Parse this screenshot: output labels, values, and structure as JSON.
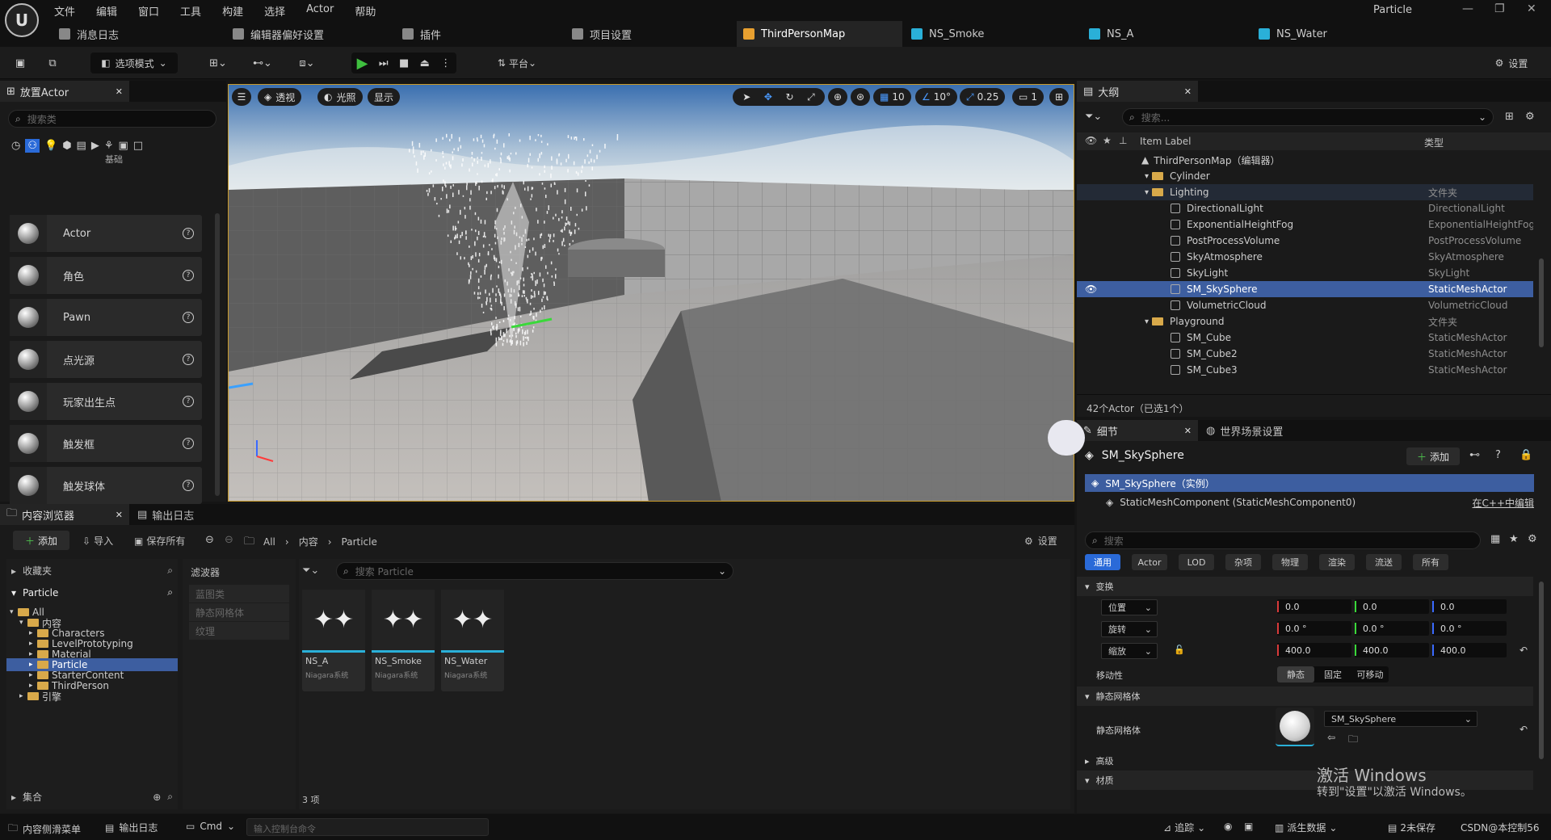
{
  "menus": [
    "文件",
    "编辑",
    "窗口",
    "工具",
    "构建",
    "选择",
    "Actor",
    "帮助"
  ],
  "project_name": "Particle",
  "tabs": [
    {
      "label": "消息日志",
      "icon": "message-log-icon"
    },
    {
      "label": "编辑器偏好设置",
      "icon": "sliders-icon"
    },
    {
      "label": "插件",
      "icon": "plugin-icon"
    },
    {
      "label": "项目设置",
      "icon": "gear-icon"
    },
    {
      "label": "ThirdPersonMap",
      "icon": "level-icon"
    },
    {
      "label": "NS_Smoke",
      "icon": "niagara-icon"
    },
    {
      "label": "NS_A",
      "icon": "niagara-icon"
    },
    {
      "label": "NS_Water",
      "icon": "niagara-icon"
    }
  ],
  "toolbar": {
    "mode": "选项模式",
    "platform": "平台",
    "settings": "设置"
  },
  "place_actor": {
    "title": "放置Actor",
    "search_placeholder": "搜索类",
    "category": "基础",
    "items": [
      "Actor",
      "角色",
      "Pawn",
      "点光源",
      "玩家出生点",
      "触发框",
      "触发球体"
    ]
  },
  "viewport": {
    "perspective": "透视",
    "lit": "光照",
    "show": "显示",
    "grid": "10",
    "angle": "10°",
    "scale": "0.25",
    "camera": "1"
  },
  "outliner": {
    "title": "大纲",
    "search_placeholder": "搜索...",
    "col_label": "Item Label",
    "col_type": "类型",
    "rows": [
      {
        "label": "ThirdPersonMap（编辑器）",
        "type": "",
        "indent": 0,
        "kind": "level"
      },
      {
        "label": "Cylinder",
        "type": "",
        "indent": 1,
        "kind": "folder"
      },
      {
        "label": "Lighting",
        "type": "文件夹",
        "indent": 1,
        "kind": "folder"
      },
      {
        "label": "DirectionalLight",
        "type": "DirectionalLight",
        "indent": 2,
        "kind": "actor"
      },
      {
        "label": "ExponentialHeightFog",
        "type": "ExponentialHeightFog",
        "indent": 2,
        "kind": "actor"
      },
      {
        "label": "PostProcessVolume",
        "type": "PostProcessVolume",
        "indent": 2,
        "kind": "actor"
      },
      {
        "label": "SkyAtmosphere",
        "type": "SkyAtmosphere",
        "indent": 2,
        "kind": "actor"
      },
      {
        "label": "SkyLight",
        "type": "SkyLight",
        "indent": 2,
        "kind": "actor"
      },
      {
        "label": "SM_SkySphere",
        "type": "StaticMeshActor",
        "indent": 2,
        "kind": "actor",
        "selected": true
      },
      {
        "label": "VolumetricCloud",
        "type": "VolumetricCloud",
        "indent": 2,
        "kind": "actor"
      },
      {
        "label": "Playground",
        "type": "文件夹",
        "indent": 1,
        "kind": "folder"
      },
      {
        "label": "SM_Cube",
        "type": "StaticMeshActor",
        "indent": 2,
        "kind": "actor"
      },
      {
        "label": "SM_Cube2",
        "type": "StaticMeshActor",
        "indent": 2,
        "kind": "actor"
      },
      {
        "label": "SM_Cube3",
        "type": "StaticMeshActor",
        "indent": 2,
        "kind": "actor"
      }
    ],
    "count": "42个Actor（已选1个）"
  },
  "details": {
    "tab": "细节",
    "tab2": "世界场景设置",
    "actor_name": "SM_SkySphere",
    "add": "添加",
    "instance": "SM_SkySphere（实例）",
    "component": "StaticMeshComponent (StaticMeshComponent0)",
    "edit_cpp": "在C++中编辑",
    "search_placeholder": "搜索",
    "categories": [
      "通用",
      "Actor",
      "LOD",
      "杂项",
      "物理",
      "渲染",
      "流送",
      "所有"
    ],
    "transform_section": "变换",
    "location_label": "位置",
    "rotation_label": "旋转",
    "scale_label": "缩放",
    "location": [
      "0.0",
      "0.0",
      "0.0"
    ],
    "rotation": [
      "0.0 °",
      "0.0 °",
      "0.0 °"
    ],
    "scale": [
      "400.0",
      "400.0",
      "400.0"
    ],
    "mobility_label": "移动性",
    "mobility": [
      "静态",
      "固定",
      "可移动"
    ],
    "mesh_section": "静态网格体",
    "mesh_label": "静态网格体",
    "mesh_value": "SM_SkySphere",
    "advanced": "高级",
    "materials": "材质"
  },
  "content_browser": {
    "tab": "内容浏览器",
    "tab2": "输出日志",
    "add": "添加",
    "import": "导入",
    "save_all": "保存所有",
    "path": [
      "All",
      "内容",
      "Particle"
    ],
    "settings": "设置",
    "favorites": "收藏夹",
    "root": "Particle",
    "tree": [
      {
        "label": "All",
        "indent": 0
      },
      {
        "label": "内容",
        "indent": 1
      },
      {
        "label": "Characters",
        "indent": 2
      },
      {
        "label": "LevelPrototyping",
        "indent": 2
      },
      {
        "label": "Material",
        "indent": 2
      },
      {
        "label": "Particle",
        "indent": 2,
        "selected": true
      },
      {
        "label": "StarterContent",
        "indent": 2
      },
      {
        "label": "ThirdPerson",
        "indent": 2
      },
      {
        "label": "引擎",
        "indent": 1
      }
    ],
    "collections": "集合",
    "filters_title": "滤波器",
    "filters": [
      "蓝图类",
      "静态网格体",
      "纹理"
    ],
    "search_placeholder": "搜索 Particle",
    "assets": [
      {
        "name": "NS_A",
        "type": "Niagara系统"
      },
      {
        "name": "NS_Smoke",
        "type": "Niagara系统"
      },
      {
        "name": "NS_Water",
        "type": "Niagara系统"
      }
    ],
    "count": "3 项"
  },
  "statusbar": {
    "drawer": "内容侧滑菜单",
    "output": "输出日志",
    "cmd": "Cmd",
    "console_placeholder": "输入控制台命令",
    "trace": "追踪",
    "derived": "派生数据",
    "unsaved": "2未保存",
    "source": "CSDN@本控制56"
  },
  "watermark": {
    "line1": "激活 Windows",
    "line2": "转到\"设置\"以激活 Windows。"
  }
}
